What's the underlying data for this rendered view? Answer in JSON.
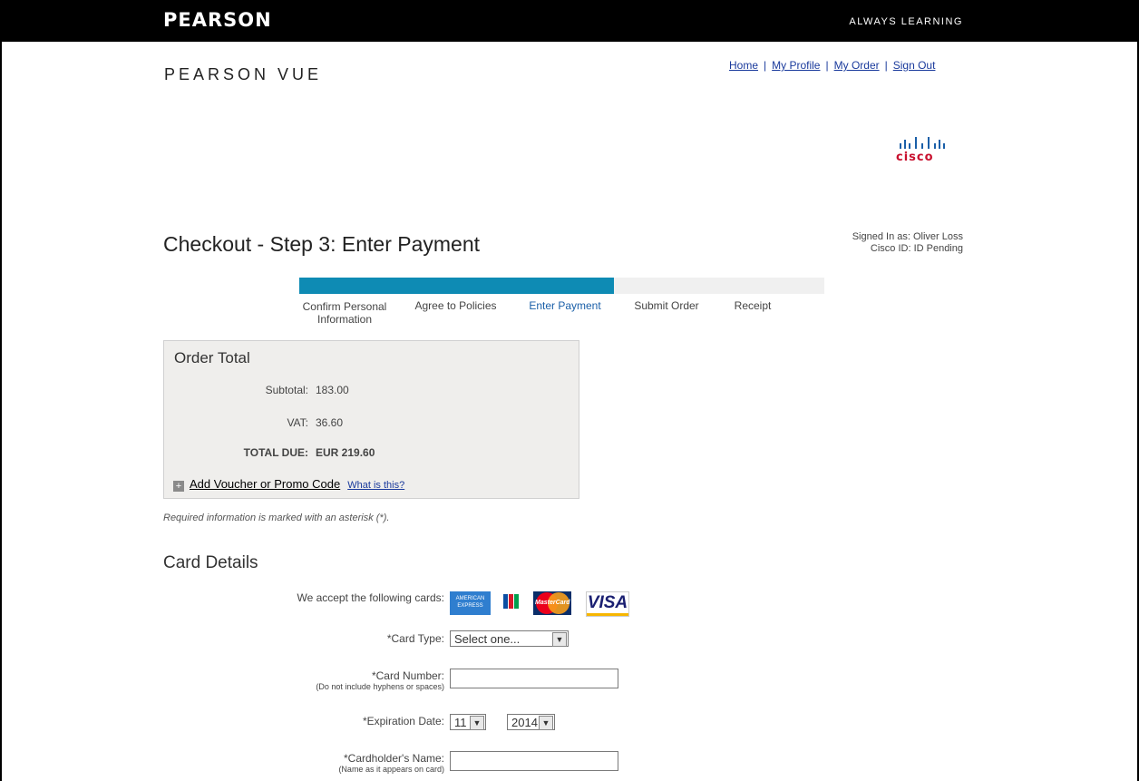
{
  "header": {
    "brand": "PEARSON",
    "tagline": "ALWAYS LEARNING"
  },
  "site": {
    "name": "PEARSON VUE"
  },
  "nav": {
    "home": "Home",
    "profile": "My Profile",
    "order": "My Order",
    "signout": "Sign Out"
  },
  "sponsor": {
    "logo_text": "cisco"
  },
  "user": {
    "signed_in": "Signed In as: Oliver Loss",
    "cisco_id": "Cisco ID: ID Pending"
  },
  "page": {
    "title": "Checkout - Step 3: Enter Payment"
  },
  "progress": {
    "fraction": 0.6
  },
  "steps": [
    "Confirm Personal Information",
    "Agree to Policies",
    "Enter Payment",
    "Submit Order",
    "Receipt"
  ],
  "order": {
    "title": "Order Total",
    "subtotal_label": "Subtotal:",
    "subtotal": "183.00",
    "vat_label": "VAT:",
    "vat": "36.60",
    "total_label": "TOTAL DUE:",
    "total": "EUR 219.60",
    "voucher_link": "Add Voucher or Promo Code",
    "what_link": "What is this?"
  },
  "required_note": "Required information is marked with an asterisk (*).",
  "card_details": {
    "title": "Card Details",
    "accept_label": "We accept the following cards:",
    "amex": "AMERICAN EXPRESS",
    "mastercard": "MasterCard",
    "visa": "VISA",
    "card_type_label": "*Card Type:",
    "card_type_value": "Select one...",
    "card_number_label": "*Card Number:",
    "card_number_hint": "(Do not include hyphens or spaces)",
    "exp_label": "*Expiration Date:",
    "exp_month": "11",
    "exp_year": "2014",
    "holder_label": "*Cardholder's Name:",
    "holder_hint": "(Name as it appears on card)"
  }
}
